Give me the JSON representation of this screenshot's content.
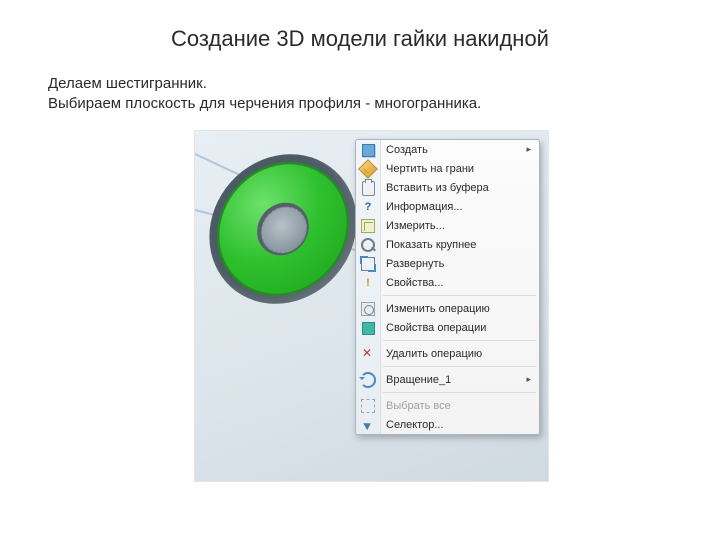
{
  "title": "Создание 3D модели гайки накидной",
  "body": {
    "line1": "Делаем шестигранник.",
    "line2": "Выбираем плоскость для черчения профиля - многогранника."
  },
  "menu": {
    "items": [
      {
        "key": "create",
        "label": "Создать",
        "icon": "sq",
        "has_submenu": true,
        "disabled": false
      },
      {
        "key": "sketch",
        "label": "Чертить на грани",
        "icon": "pencil",
        "has_submenu": false,
        "disabled": false
      },
      {
        "key": "paste",
        "label": "Вставить из буфера",
        "icon": "clip",
        "has_submenu": false,
        "disabled": false
      },
      {
        "key": "info",
        "label": "Информация...",
        "icon": "qmark",
        "has_submenu": false,
        "disabled": false
      },
      {
        "key": "measure",
        "label": "Измерить...",
        "icon": "ruler",
        "has_submenu": false,
        "disabled": false
      },
      {
        "key": "zoom",
        "label": "Показать крупнее",
        "icon": "zoom",
        "has_submenu": false,
        "disabled": false
      },
      {
        "key": "expand",
        "label": "Развернуть",
        "icon": "expand",
        "has_submenu": false,
        "disabled": false
      },
      {
        "key": "props",
        "label": "Свойства...",
        "icon": "bang",
        "has_submenu": false,
        "disabled": false
      },
      {
        "key": "sep1",
        "separator": true
      },
      {
        "key": "editop",
        "label": "Изменить операцию",
        "icon": "gearbox",
        "has_submenu": false,
        "disabled": false
      },
      {
        "key": "opprops",
        "label": "Свойства операции",
        "icon": "tealbox",
        "has_submenu": false,
        "disabled": false
      },
      {
        "key": "sep2",
        "separator": true
      },
      {
        "key": "delop",
        "label": "Удалить операцию",
        "icon": "trash",
        "has_submenu": false,
        "disabled": false
      },
      {
        "key": "sep3",
        "separator": true
      },
      {
        "key": "rev1",
        "label": "Вращение_1",
        "icon": "rot",
        "has_submenu": true,
        "disabled": false
      },
      {
        "key": "sep4",
        "separator": true
      },
      {
        "key": "selectall",
        "label": "Выбрать все",
        "icon": "selall",
        "has_submenu": false,
        "disabled": true
      },
      {
        "key": "selector",
        "label": "Селектор...",
        "icon": "cursor",
        "has_submenu": false,
        "disabled": false
      }
    ]
  }
}
